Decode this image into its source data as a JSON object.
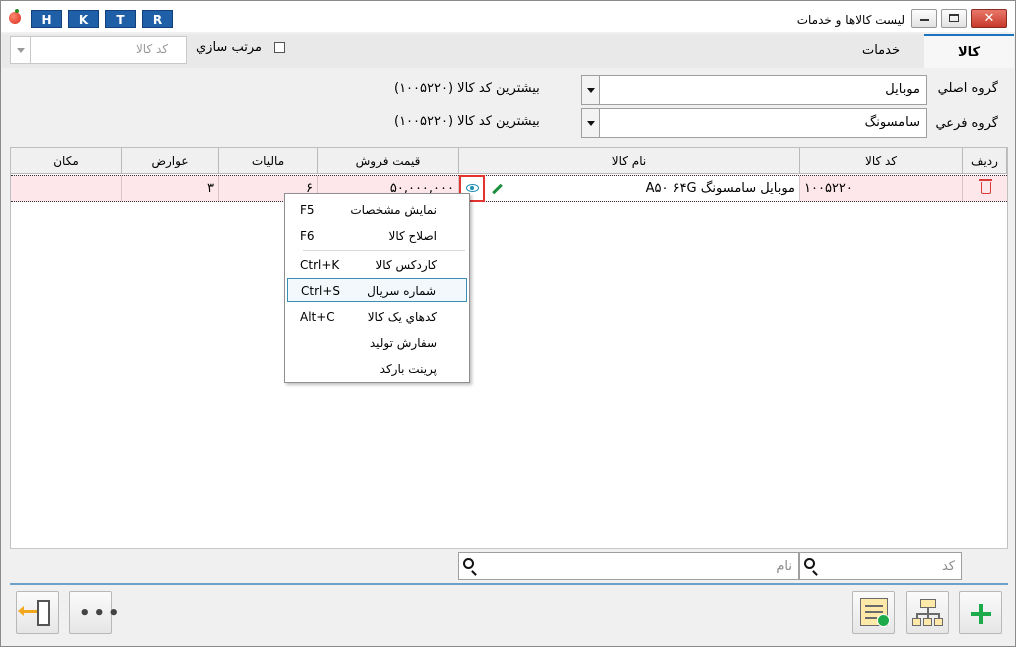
{
  "window": {
    "title": "ليست كالاها و خدمات",
    "shortcut_buttons": [
      "H",
      "K",
      "T",
      "R"
    ]
  },
  "tabs": {
    "goods": "كالا",
    "services": "خدمات"
  },
  "sort": {
    "label": "مرتب سازي",
    "placeholder": "کد کالا"
  },
  "filters": {
    "main_group_label": "گروه اصلي",
    "main_group_value": "موبايل",
    "sub_group_label": "گروه فرعي",
    "sub_group_value": "سامسونگ",
    "max_code_main": "بيشترين کد کالا (۱۰۰۵۲۲۰)",
    "max_code_sub": "بيشترين کد کالا (۱۰۰۵۲۲۰)"
  },
  "grid": {
    "columns": {
      "row": "رديف",
      "code": "کد کالا",
      "name": "نام کالا",
      "price": "قيمت فروش",
      "tax": "ماليات",
      "duties": "عوارض",
      "location": "مکان"
    },
    "rows": [
      {
        "code": "۱۰۰۵۲۲۰",
        "name": "موبايل سامسونگ A۵۰ ۶۴G",
        "price": "۵۰,۰۰۰,۰۰۰",
        "tax": "۶",
        "duties": "۳",
        "location": ""
      }
    ]
  },
  "context_menu": [
    {
      "label": "نمايش مشخصات",
      "shortcut": "F5"
    },
    {
      "label": "اصلاح کالا",
      "shortcut": "F6"
    },
    {
      "label": "کاردکس کالا",
      "shortcut": "Ctrl+K"
    },
    {
      "label": "شماره سريال",
      "shortcut": "Ctrl+S"
    },
    {
      "label": "کدهاي يک کالا",
      "shortcut": "Alt+C"
    },
    {
      "label": "سفارش توليد",
      "shortcut": ""
    },
    {
      "label": "پرينت بارکد",
      "shortcut": ""
    }
  ],
  "search": {
    "code_placeholder": "کد",
    "name_placeholder": "نام"
  },
  "colors": {
    "selected_row": "#fde7ea",
    "accent": "#1e73be",
    "add_green": "#1daa4a"
  }
}
